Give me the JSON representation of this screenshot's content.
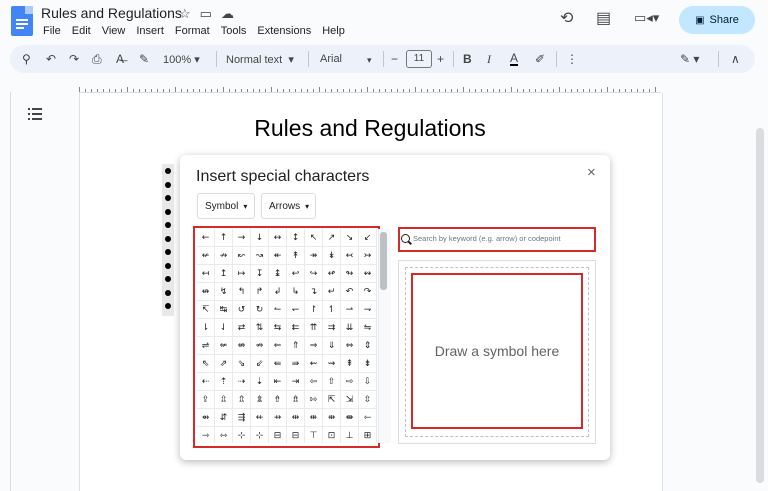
{
  "app": {
    "doc_title": "Rules and Regulations",
    "title_icons": [
      "star-icon",
      "move-folder-icon",
      "cloud-status-icon"
    ],
    "menu": [
      "File",
      "Edit",
      "View",
      "Insert",
      "Format",
      "Tools",
      "Extensions",
      "Help"
    ],
    "header_icons": [
      "history-icon",
      "comments-icon",
      "meet-icon"
    ],
    "share_label": "Share",
    "colors": {
      "share_bg": "#c2e7ff",
      "toolbar_bg": "#edf2fa",
      "highlight_red": "#d42a2a",
      "doc_blue": "#4285f4"
    }
  },
  "toolbar": {
    "zoom": "100%",
    "style": "Normal text",
    "font": "Arial",
    "font_size": "11",
    "minus": "−",
    "plus": "+",
    "bold": "B",
    "italic": "I",
    "text_color": "A",
    "more": "⋮",
    "collapse": "∧"
  },
  "document": {
    "heading": "Rules and Regulations"
  },
  "dialog": {
    "title": "Insert special characters",
    "close": "×",
    "category_dropdown": "Symbol",
    "subcategory_dropdown": "Arrows",
    "search_placeholder": "Search by keyword (e.g. arrow) or codepoint",
    "draw_prompt": "Draw a symbol here",
    "symbols": [
      [
        "←",
        "↑",
        "→",
        "↓",
        "↔",
        "↕",
        "↖",
        "↗",
        "↘",
        "↙"
      ],
      [
        "↚",
        "↛",
        "↜",
        "↝",
        "↞",
        "↟",
        "↠",
        "↡",
        "↢",
        "↣"
      ],
      [
        "↤",
        "↥",
        "↦",
        "↧",
        "↨",
        "↩",
        "↪",
        "↫",
        "↬",
        "↭"
      ],
      [
        "↮",
        "↯",
        "↰",
        "↱",
        "↲",
        "↳",
        "↴",
        "↵",
        "↶",
        "↷"
      ],
      [
        "↸",
        "↹",
        "↺",
        "↻",
        "↼",
        "↽",
        "↾",
        "↿",
        "⇀",
        "⇁"
      ],
      [
        "⇂",
        "⇃",
        "⇄",
        "⇅",
        "⇆",
        "⇇",
        "⇈",
        "⇉",
        "⇊",
        "⇋"
      ],
      [
        "⇌",
        "⇍",
        "⇎",
        "⇏",
        "⇐",
        "⇑",
        "⇒",
        "⇓",
        "⇔",
        "⇕"
      ],
      [
        "⇖",
        "⇗",
        "⇘",
        "⇙",
        "⇚",
        "⇛",
        "⇜",
        "⇝",
        "⇞",
        "⇟"
      ],
      [
        "⇠",
        "⇡",
        "⇢",
        "⇣",
        "⇤",
        "⇥",
        "⇦",
        "⇧",
        "⇨",
        "⇩"
      ],
      [
        "⇪",
        "⇫",
        "⇬",
        "⇭",
        "⇮",
        "⇯",
        "⇰",
        "⇱",
        "⇲",
        "⇳"
      ],
      [
        "⇴",
        "⇵",
        "⇶",
        "⇷",
        "⇸",
        "⇹",
        "⇺",
        "⇻",
        "⇼",
        "⇽"
      ],
      [
        "⇾",
        "⇿",
        "⊹",
        "⊹",
        "⊟",
        "⊟",
        "⊤",
        "⊡",
        "⊥",
        "⊞"
      ]
    ]
  }
}
